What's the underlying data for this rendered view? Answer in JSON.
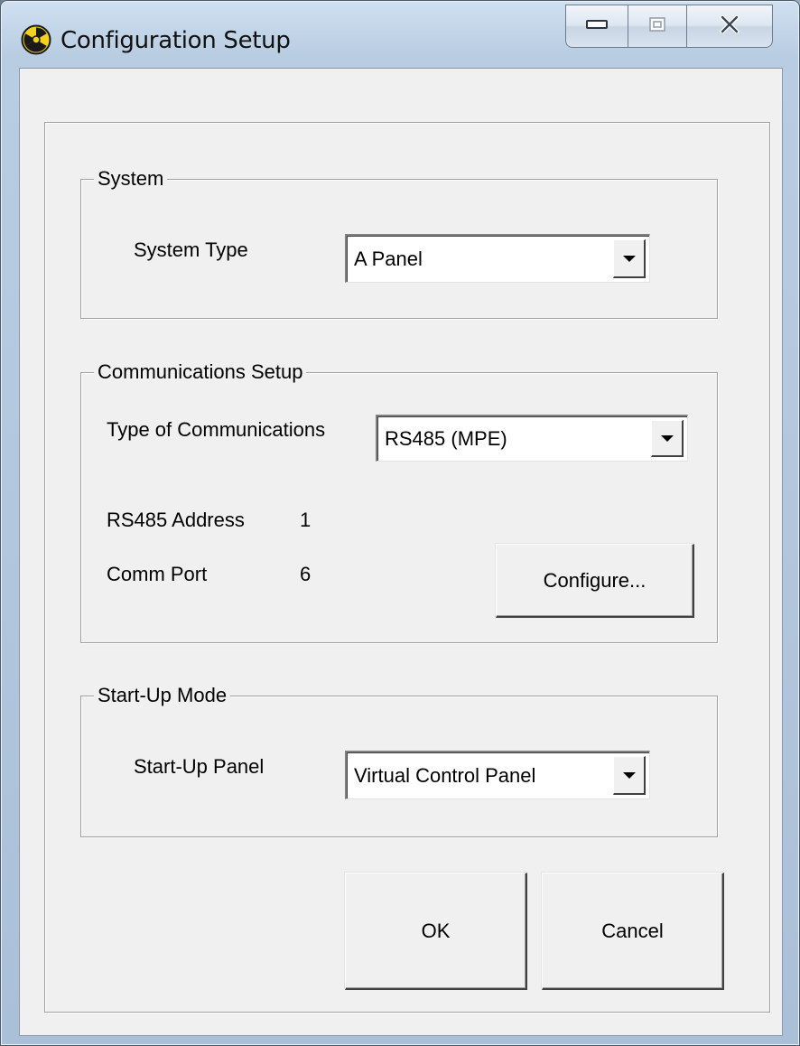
{
  "window": {
    "title": "Configuration Setup",
    "app_icon": "radiation-icon",
    "caption_buttons": [
      "minimize",
      "maximize",
      "close"
    ]
  },
  "system_group": {
    "title": "System",
    "system_type_label": "System Type",
    "system_type_value": "A Panel"
  },
  "comm_group": {
    "title": "Communications Setup",
    "type_label": "Type of Communications",
    "type_value": "RS485 (MPE)",
    "address_label": "RS485 Address",
    "address_value": "1",
    "port_label": "Comm Port",
    "port_value": "6",
    "configure_label": "Configure..."
  },
  "startup_group": {
    "title": "Start-Up Mode",
    "panel_label": "Start-Up Panel",
    "panel_value": "Virtual Control Panel"
  },
  "buttons": {
    "ok_label": "OK",
    "cancel_label": "Cancel"
  }
}
